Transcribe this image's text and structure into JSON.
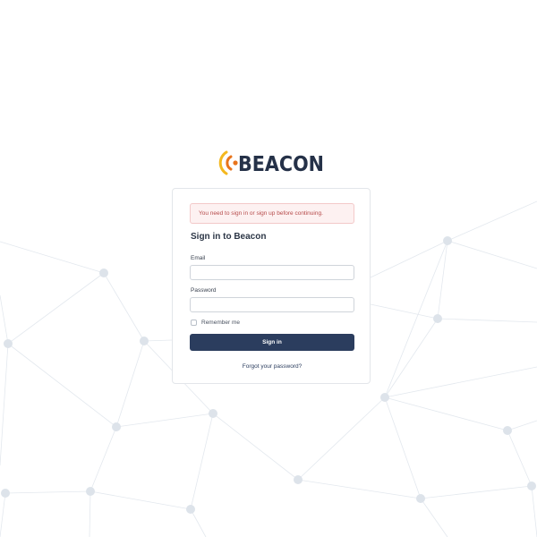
{
  "brand": {
    "name": "BEACON",
    "colors": {
      "text": "#253148",
      "wave_inner": "#e8741c",
      "wave_outer": "#f4b81f"
    }
  },
  "alert": {
    "message": "You need to sign in or sign up before continuing."
  },
  "form": {
    "title": "Sign in to Beacon",
    "email_label": "Email",
    "email_value": "",
    "password_label": "Password",
    "password_value": "",
    "remember_label": "Remember me",
    "remember_checked": false,
    "submit_label": "Sign in",
    "forgot_link": "Forgot your password?"
  },
  "colors": {
    "primary": "#2b3d5e",
    "alert_bg": "#fdf1f1",
    "alert_text": "#b64b4b",
    "network": "#dde3ea"
  }
}
